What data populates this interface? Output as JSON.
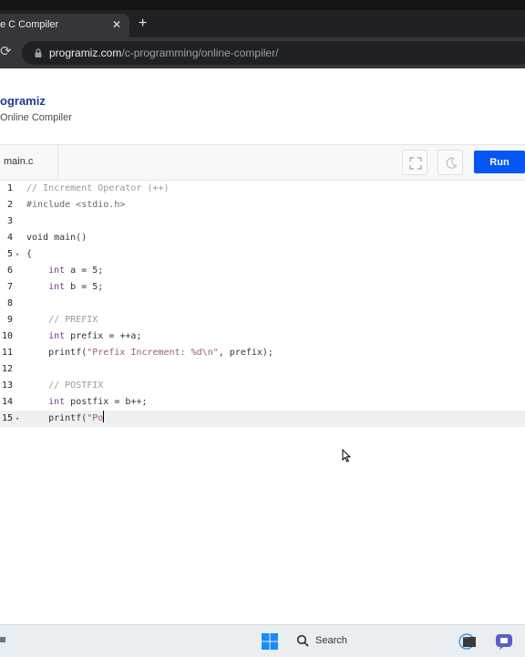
{
  "browser": {
    "tab_title": "e C Compiler",
    "close_glyph": "✕",
    "new_tab_glyph": "+",
    "url_host": "programiz.com",
    "url_path": "/c-programming/online-compiler/"
  },
  "site": {
    "brand": "ogramiz",
    "subtitle": "Online Compiler"
  },
  "editor": {
    "file_name": "main.c",
    "run_label": "Run",
    "lines": [
      {
        "n": "1",
        "fold": ""
      },
      {
        "n": "2",
        "fold": ""
      },
      {
        "n": "3",
        "fold": ""
      },
      {
        "n": "4",
        "fold": ""
      },
      {
        "n": "5",
        "fold": "▾"
      },
      {
        "n": "6",
        "fold": ""
      },
      {
        "n": "7",
        "fold": ""
      },
      {
        "n": "8",
        "fold": ""
      },
      {
        "n": "9",
        "fold": ""
      },
      {
        "n": "10",
        "fold": ""
      },
      {
        "n": "11",
        "fold": ""
      },
      {
        "n": "12",
        "fold": ""
      },
      {
        "n": "13",
        "fold": ""
      },
      {
        "n": "14",
        "fold": ""
      },
      {
        "n": "15",
        "fold": "▾"
      }
    ],
    "code": {
      "l1": "// Increment Operator (++)",
      "l2": "#include <stdio.h>",
      "l3": "",
      "l4": "void main()",
      "l5": "{",
      "l6_type": "int",
      "l6_rest": " a = 5;",
      "l7_type": "int",
      "l7_rest": " b = 5;",
      "l8": "",
      "l9": "// PREFIX",
      "l10_type": "int",
      "l10_rest": " prefix = ++a;",
      "l11_fn": "printf(",
      "l11_str": "\"Prefix Increment: %d\\n\"",
      "l11_rest": ", prefix);",
      "l12": "",
      "l13": "// POSTFIX",
      "l14_type": "int",
      "l14_rest": " postfix = b++;",
      "l15_fn": "printf(",
      "l15_str": "\"Po"
    }
  },
  "taskbar": {
    "search_label": "Search"
  }
}
